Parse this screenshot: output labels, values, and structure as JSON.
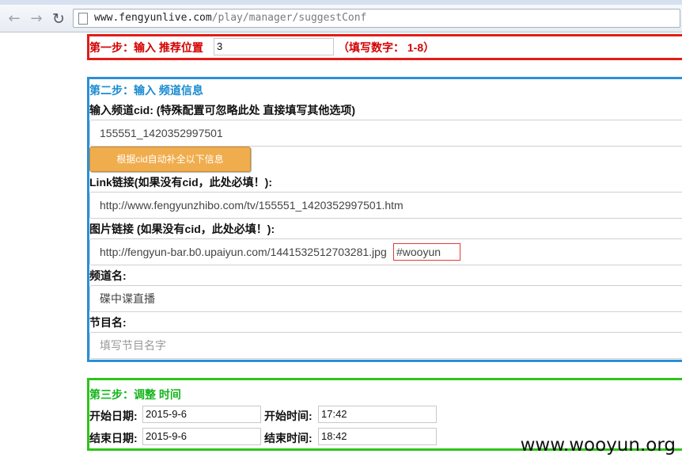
{
  "browser": {
    "url_host": "www.fengyunlive.com",
    "url_path": "/play/manager/suggestConf"
  },
  "step1": {
    "heading": "第一步：输入 推荐位置",
    "position_value": "3",
    "hint": "（填写数字： 1-8）"
  },
  "step2": {
    "heading": "第二步：输入 频道信息",
    "cid_label": "输入频道cid: (特殊配置可忽略此处 直接填写其他选项)",
    "cid_value": "155551_1420352997501",
    "autofill_button": "根据cid自动补全以下信息",
    "link_label": "Link链接(如果没有cid，此处必填！):",
    "link_value": "http://www.fengyunzhibo.com/tv/155551_1420352997501.htm",
    "image_label": "图片链接 (如果没有cid，此处必填！):",
    "image_value": "http://fengyun-bar.b0.upaiyun.com/1441532512703281.jpg",
    "image_suffix": "#wooyun",
    "channel_label": "频道名:",
    "channel_value": "碟中谍直播",
    "program_label": "节目名:",
    "program_placeholder": "填写节目名字"
  },
  "step3": {
    "heading": "第三步：调整 时间",
    "start_date_label": "开始日期:",
    "start_date_value": "2015-9-6",
    "start_time_label": "开始时间:",
    "start_time_value": "17:42",
    "end_date_label": "结束日期:",
    "end_date_value": "2015-9-6",
    "end_time_label": "结束时间:",
    "end_time_value": "18:42"
  },
  "watermark": "www.wooyun.org",
  "colors": {
    "step1_border": "#e41b17",
    "step2_border": "#2b8fd6",
    "step3_border": "#2fc41a",
    "button": "#f0ad4e"
  },
  "icons": [
    "back-arrow-icon",
    "forward-arrow-icon",
    "reload-icon",
    "page-icon"
  ]
}
